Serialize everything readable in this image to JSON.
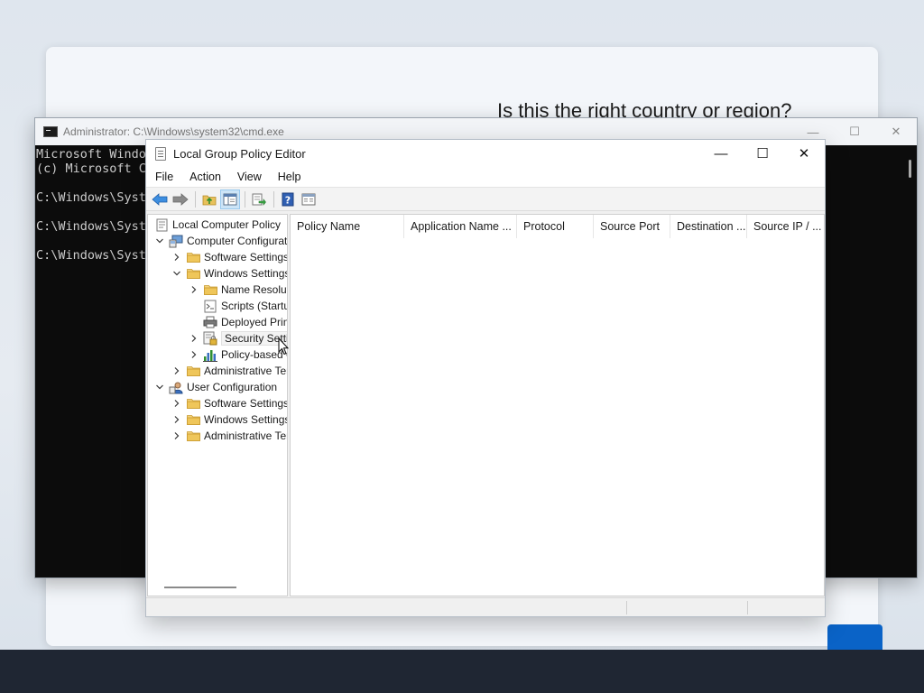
{
  "oobe": {
    "title": "Is this the right country or region?"
  },
  "cmd": {
    "title": "Administrator: C:\\Windows\\system32\\cmd.exe",
    "lines": [
      "Microsoft Windows",
      "(c) Microsoft Corporation",
      "",
      "C:\\Windows\\System32>",
      "",
      "C:\\Windows\\System32>",
      "",
      "C:\\Windows\\System32>"
    ],
    "controls": {
      "minimize": "—",
      "maximize": "☐",
      "close": "✕"
    }
  },
  "gpedit": {
    "title": "Local Group Policy Editor",
    "controls": {
      "minimize": "—",
      "maximize": "☐",
      "close": "✕"
    },
    "menu": [
      "File",
      "Action",
      "View",
      "Help"
    ],
    "toolbar": [
      "back-icon",
      "forward-icon",
      "up-folder-icon",
      "show-hide-tree-icon",
      "export-list-icon",
      "help-icon",
      "extended-view-icon"
    ],
    "tree": [
      {
        "label": "Local Computer Policy",
        "level": 0,
        "expander": "none",
        "icon": "policy-icon"
      },
      {
        "label": "Computer Configuration",
        "level": 1,
        "expander": "expanded",
        "icon": "computer-icon"
      },
      {
        "label": "Software Settings",
        "level": 2,
        "expander": "collapsed",
        "icon": "folder-icon"
      },
      {
        "label": "Windows Settings",
        "level": 2,
        "expander": "expanded",
        "icon": "folder-icon"
      },
      {
        "label": "Name Resolution Policy",
        "level": 3,
        "expander": "collapsed",
        "icon": "folder-icon"
      },
      {
        "label": "Scripts (Startup/Shutdown)",
        "level": 3,
        "expander": "none",
        "icon": "script-icon"
      },
      {
        "label": "Deployed Printers",
        "level": 3,
        "expander": "none",
        "icon": "printer-icon"
      },
      {
        "label": "Security Settings",
        "level": 3,
        "expander": "collapsed",
        "icon": "security-icon",
        "hover": true
      },
      {
        "label": "Policy-based QoS",
        "level": 3,
        "expander": "collapsed",
        "icon": "qos-icon"
      },
      {
        "label": "Administrative Templates",
        "level": 2,
        "expander": "collapsed",
        "icon": "folder-icon"
      },
      {
        "label": "User Configuration",
        "level": 1,
        "expander": "expanded",
        "icon": "user-icon"
      },
      {
        "label": "Software Settings",
        "level": 2,
        "expander": "collapsed",
        "icon": "folder-icon"
      },
      {
        "label": "Windows Settings",
        "level": 2,
        "expander": "collapsed",
        "icon": "folder-icon"
      },
      {
        "label": "Administrative Templates",
        "level": 2,
        "expander": "collapsed",
        "icon": "folder-icon"
      }
    ],
    "columns": [
      "Policy Name",
      "Application Name ...",
      "Protocol",
      "Source Port",
      "Destination ...",
      "Source IP / ..."
    ]
  },
  "colors": {
    "accent": "#0a63c7",
    "selection": "#cce4f7",
    "folder": "#e8c15b"
  }
}
